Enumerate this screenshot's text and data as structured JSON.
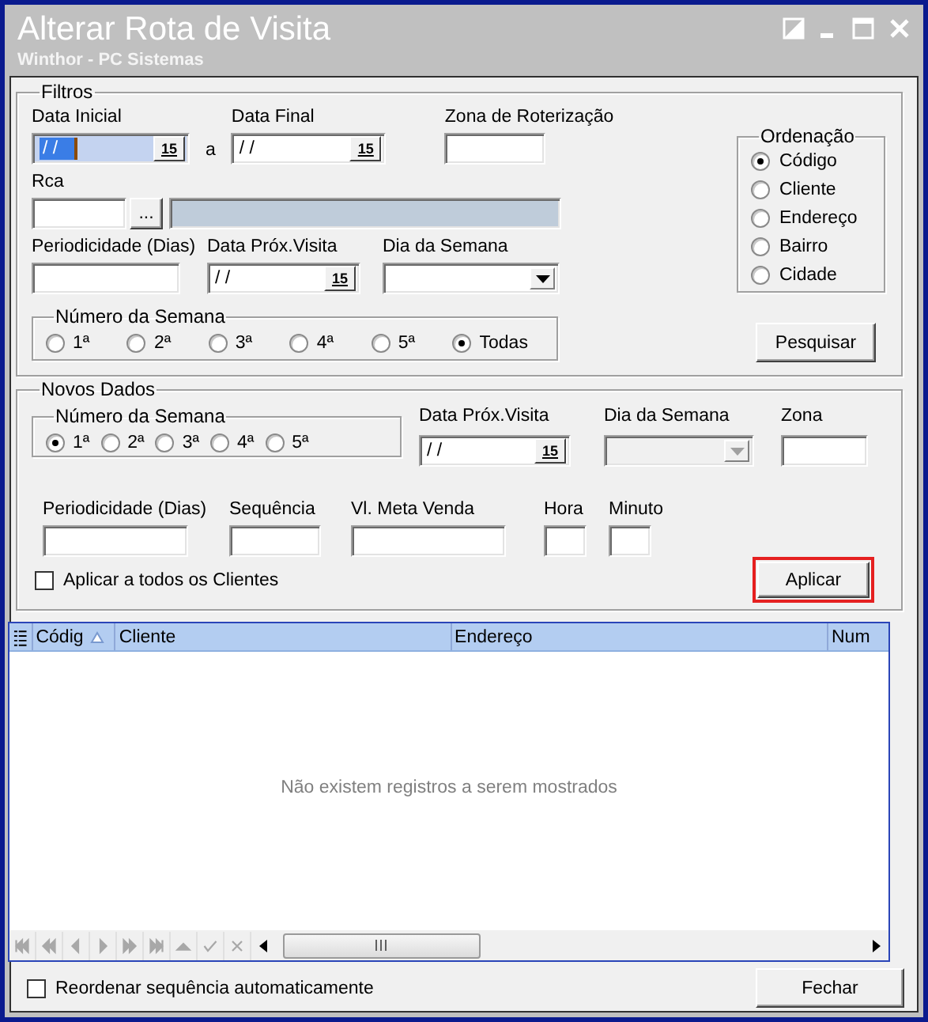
{
  "window": {
    "title": "Alterar Rota de Visita",
    "subtitle": "Winthor - PC Sistemas"
  },
  "filtros": {
    "title": "Filtros",
    "data_inicial": {
      "label": "Data Inicial",
      "value": "/ /",
      "picker": "15",
      "focused": true
    },
    "range_separator": "a",
    "data_final": {
      "label": "Data Final",
      "value": "/ /",
      "picker": "15",
      "focused": false
    },
    "zona": {
      "label": "Zona de Roterização"
    },
    "rca": {
      "label": "Rca",
      "button": "..."
    },
    "periodicidade": {
      "label": "Periodicidade (Dias)"
    },
    "data_prox": {
      "label": "Data Próx.Visita",
      "value": "/ /",
      "picker": "15",
      "focused": false
    },
    "dia_semana": {
      "label": "Dia da Semana",
      "disabled": false
    },
    "numero_semana": {
      "title": "Número da Semana",
      "options": [
        {
          "label": "1ª",
          "selected": false
        },
        {
          "label": "2ª",
          "selected": false
        },
        {
          "label": "3ª",
          "selected": false
        },
        {
          "label": "4ª",
          "selected": false
        },
        {
          "label": "5ª",
          "selected": false
        },
        {
          "label": "Todas",
          "selected": true
        }
      ]
    },
    "ordenacao": {
      "title": "Ordenação",
      "options": [
        {
          "label": "Código",
          "selected": true
        },
        {
          "label": "Cliente",
          "selected": false
        },
        {
          "label": "Endereço",
          "selected": false
        },
        {
          "label": "Bairro",
          "selected": false
        },
        {
          "label": "Cidade",
          "selected": false
        }
      ]
    },
    "search_button": "Pesquisar"
  },
  "novos_dados": {
    "title": "Novos Dados",
    "numero_semana": {
      "title": "Número da Semana",
      "options": [
        {
          "label": "1ª",
          "selected": true
        },
        {
          "label": "2ª",
          "selected": false
        },
        {
          "label": "3ª",
          "selected": false
        },
        {
          "label": "4ª",
          "selected": false
        },
        {
          "label": "5ª",
          "selected": false
        }
      ]
    },
    "data_prox": {
      "label": "Data Próx.Visita",
      "value": "/ /",
      "picker": "15",
      "focused": false
    },
    "dia_semana": {
      "label": "Dia da Semana",
      "disabled": true
    },
    "zona": {
      "label": "Zona"
    },
    "periodicidade": {
      "label": "Periodicidade (Dias)"
    },
    "sequencia": {
      "label": "Sequência"
    },
    "meta_venda": {
      "label": "Vl. Meta Venda"
    },
    "hora": {
      "label": "Hora"
    },
    "minuto": {
      "label": "Minuto"
    },
    "apply_all": {
      "label": "Aplicar a todos os Clientes",
      "checked": false
    },
    "apply_button": {
      "label": "Aplicar",
      "highlighted": true
    }
  },
  "grid": {
    "columns": [
      {
        "label": "Códig",
        "sorted": true
      },
      {
        "label": "Cliente",
        "sorted": false
      },
      {
        "label": "Endereço",
        "sorted": false
      },
      {
        "label": "Num",
        "sorted": false
      }
    ],
    "empty_message": "Não existem registros a serem mostrados",
    "navigator": {
      "disabled": true
    }
  },
  "reorder": {
    "label": "Reordenar sequência automaticamente",
    "checked": false
  },
  "close_button": "Fechar"
}
